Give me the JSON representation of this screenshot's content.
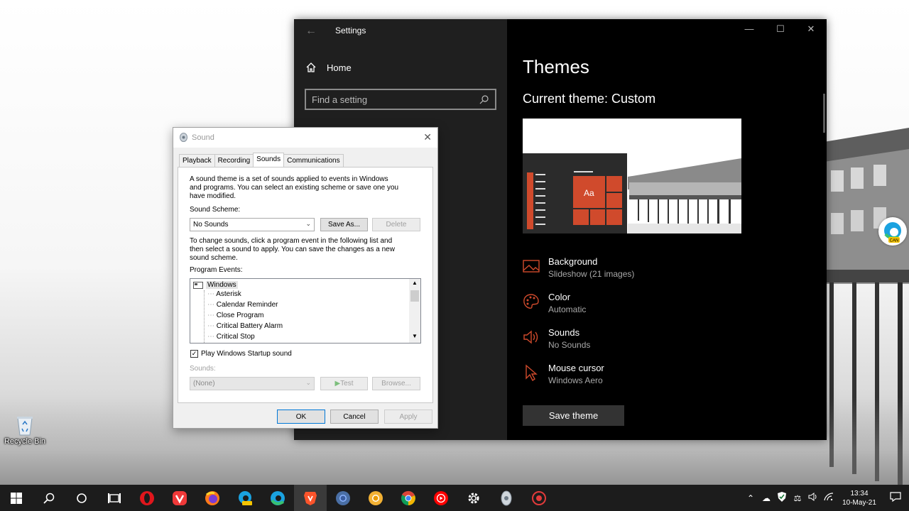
{
  "desktop": {
    "recycle_bin_label": "Recycle Bin"
  },
  "settings": {
    "window_title": "Settings",
    "nav": {
      "home_label": "Home",
      "search_placeholder": "Find a setting"
    },
    "content": {
      "heading": "Themes",
      "current_theme": "Current theme: Custom",
      "preview_tile_text": "Aa",
      "items": [
        {
          "title": "Background",
          "subtitle": "Slideshow (21 images)",
          "icon": "picture-icon"
        },
        {
          "title": "Color",
          "subtitle": "Automatic",
          "icon": "palette-icon"
        },
        {
          "title": "Sounds",
          "subtitle": "No Sounds",
          "icon": "speaker-icon"
        },
        {
          "title": "Mouse cursor",
          "subtitle": "Windows Aero",
          "icon": "cursor-icon"
        }
      ],
      "save_theme_label": "Save theme"
    },
    "accent_color": "#d04a2c"
  },
  "sound_dialog": {
    "title": "Sound",
    "tabs": [
      "Playback",
      "Recording",
      "Sounds",
      "Communications"
    ],
    "selected_tab": "Sounds",
    "intro_text": [
      "A sound theme is a set of sounds applied to events in Windows",
      "and programs.  You can select an existing scheme or save one you",
      "have modified."
    ],
    "scheme_label": "Sound Scheme:",
    "scheme_value": "No Sounds",
    "save_as_label": "Save As...",
    "delete_label": "Delete",
    "change_text": [
      "To change sounds, click a program event in the following list and",
      "then select a sound to apply.  You can save the changes as a new",
      "sound scheme."
    ],
    "program_events_label": "Program Events:",
    "events_root": "Windows",
    "events": [
      "Asterisk",
      "Calendar Reminder",
      "Close Program",
      "Critical Battery Alarm",
      "Critical Stop"
    ],
    "startup_checkbox_label": "Play Windows Startup sound",
    "sounds_label": "Sounds:",
    "sounds_value": "(None)",
    "test_label": "Test",
    "browse_label": "Browse...",
    "ok_label": "OK",
    "cancel_label": "Cancel",
    "apply_label": "Apply"
  },
  "taskbar": {
    "apps": [
      "start-icon",
      "search-icon",
      "cortana-icon",
      "task-view-icon",
      "opera-icon",
      "vivaldi-icon",
      "firefox-icon",
      "edge-can-icon",
      "edge-icon",
      "brave-icon",
      "chrome-icon",
      "chrome-canary-icon",
      "chrome-icon-2",
      "youtube-music-icon",
      "settings-gear-icon",
      "sound-app-icon",
      "record-icon"
    ],
    "active_app": "brave-icon",
    "clock_time": "13:34",
    "clock_date": "10-May-21"
  }
}
